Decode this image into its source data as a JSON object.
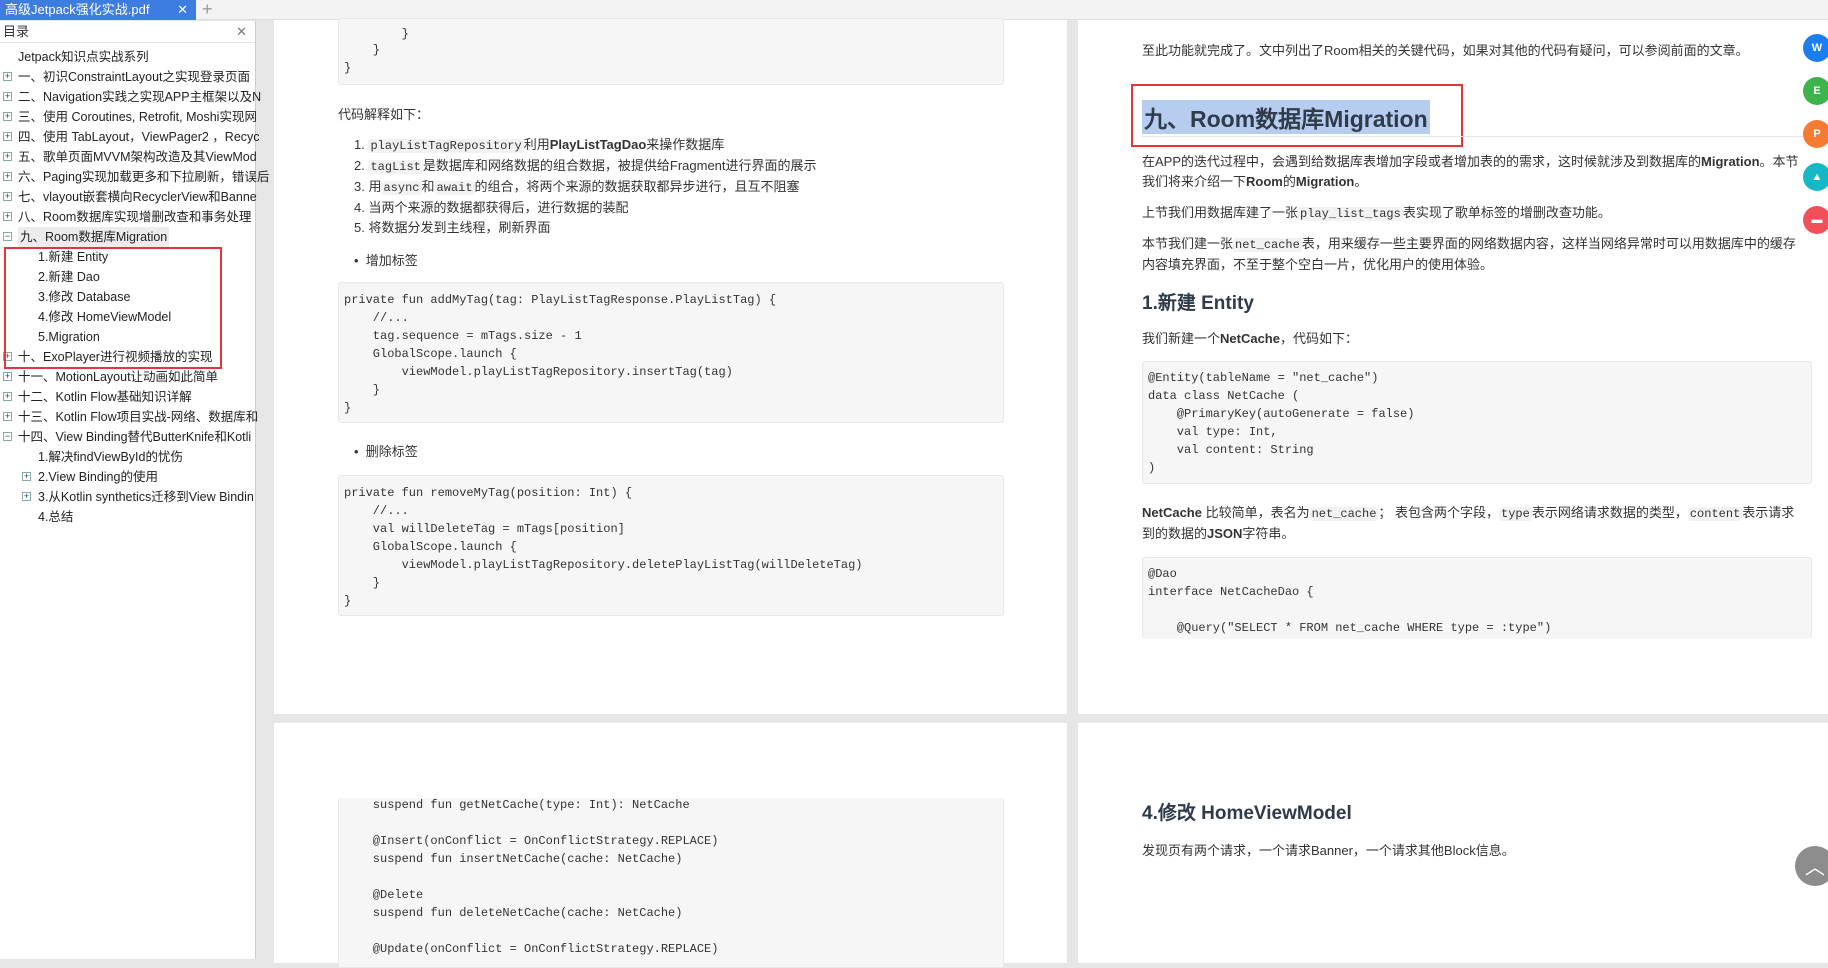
{
  "tabbar": {
    "active_tab": "高级Jetpack强化实战.pdf",
    "close": "✕",
    "new_tab": "+"
  },
  "sidebar": {
    "title": "目录",
    "close": "✕",
    "items": [
      {
        "label": "Jetpack知识点实战系列",
        "level": 0,
        "toggle": ""
      },
      {
        "label": "一、初识ConstraintLayout之实现登录页面",
        "level": 0,
        "toggle": "+"
      },
      {
        "label": "二、Navigation实践之实现APP主框架以及N",
        "level": 0,
        "toggle": "+"
      },
      {
        "label": "三、使用 Coroutines, Retrofit, Moshi实现网",
        "level": 0,
        "toggle": "+"
      },
      {
        "label": "四、使用 TabLayout，ViewPager2 ，Recyc",
        "level": 0,
        "toggle": "+"
      },
      {
        "label": "五、歌单页面MVVM架构改造及其ViewMod",
        "level": 0,
        "toggle": "+"
      },
      {
        "label": "六、Paging实现加载更多和下拉刷新，错误后",
        "level": 0,
        "toggle": "+"
      },
      {
        "label": "七、vlayout嵌套横向RecyclerView和Banne",
        "level": 0,
        "toggle": "+"
      },
      {
        "label": "八、Room数据库实现增删改查和事务处理",
        "level": 0,
        "toggle": "+"
      },
      {
        "label": "九、Room数据库Migration",
        "level": 0,
        "toggle": "-",
        "selected": true
      },
      {
        "label": "1.新建 Entity",
        "level": 1,
        "toggle": ""
      },
      {
        "label": "2.新建 Dao",
        "level": 1,
        "toggle": ""
      },
      {
        "label": "3.修改 Database",
        "level": 1,
        "toggle": ""
      },
      {
        "label": "4.修改 HomeViewModel",
        "level": 1,
        "toggle": ""
      },
      {
        "label": "5.Migration",
        "level": 1,
        "toggle": ""
      },
      {
        "label": "十、ExoPlayer进行视频播放的实现",
        "level": 0,
        "toggle": "+"
      },
      {
        "label": "十一、MotionLayout让动画如此简单",
        "level": 0,
        "toggle": "+"
      },
      {
        "label": "十二、Kotlin Flow基础知识详解",
        "level": 0,
        "toggle": "+"
      },
      {
        "label": "十三、Kotlin Flow项目实战-网络、数据库和",
        "level": 0,
        "toggle": "+"
      },
      {
        "label": "十四、View Binding替代ButterKnife和Kotli",
        "level": 0,
        "toggle": "-"
      },
      {
        "label": "1.解决findViewById的忧伤",
        "level": 1,
        "toggle": ""
      },
      {
        "label": "2.View Binding的使用",
        "level": 1,
        "toggle": "+"
      },
      {
        "label": "3.从Kotlin synthetics迁移到View Bindin",
        "level": 1,
        "toggle": "+"
      },
      {
        "label": "4.总结",
        "level": 1,
        "toggle": ""
      }
    ]
  },
  "page_left": {
    "code_top": [
      "        }",
      "    }",
      "}"
    ],
    "explain": "代码解释如下：",
    "list": [
      {
        "n": "1.",
        "code": "playListTagRepository",
        "text": "利用",
        "bold": "PlayListTagDao",
        "rest": "来操作数据库"
      },
      {
        "n": "2.",
        "code": "tagList",
        "text": "是数据库和网络数据的组合数据，被提供给Fragment进行界面的展示"
      },
      {
        "n": "3.",
        "pre": "用",
        "code": "async",
        "mid": "和",
        "code2": "await",
        "text": "的组合，将两个来源的数据获取都异步进行，且互不阻塞"
      },
      {
        "n": "4.",
        "text": "当两个来源的数据都获得后，进行数据的装配"
      },
      {
        "n": "5.",
        "text": "将数据分发到主线程，刷新界面"
      }
    ],
    "bullet_add": "增加标签",
    "code_add": [
      "private fun addMyTag(tag: PlayListTagResponse.PlayListTag) {",
      "    //...",
      "    tag.sequence = mTags.size - 1",
      "    GlobalScope.launch {",
      "        viewModel.playListTagRepository.insertTag(tag)",
      "    }",
      "}"
    ],
    "bullet_del": "删除标签",
    "code_del": [
      "private fun removeMyTag(position: Int) {",
      "    //...",
      "    val willDeleteTag = mTags[position]",
      "    GlobalScope.launch {",
      "        viewModel.playListTagRepository.deletePlayListTag(willDeleteTag)",
      "    }",
      "}"
    ]
  },
  "page_right": {
    "intro": "至此功能就完成了。文中列出了Room相关的关键代码，如果对其他的代码有疑问，可以参阅前面的文章。",
    "heading": "九、Room数据库Migration",
    "p1a": "在APP的迭代过程中，会遇到给数据库表增加字段或者增加表的的需求，这时候就涉及到数据库的",
    "p1b": "Migration",
    "p1c": "。本节",
    "p1d": "我们将来介绍一下",
    "p1e": "Room",
    "p1f": "的",
    "p1g": "Migration",
    "p1h": "。",
    "p2a": "上节我们用数据库建了一张",
    "p2code": "play_list_tags",
    "p2b": "表实现了歌单标签的增删改查功能。",
    "p3a": "本节我们建一张",
    "p3code": "net_cache",
    "p3b": "表，用来缓存一些主要界面的网络数据内容，这样当网络异常时可以用数据库中的缓存",
    "p3c": "内容填充界面，不至于整个空白一片，优化用户的使用体验。",
    "h_entity": "1.新建 Entity",
    "p4a": "我们新建一个",
    "p4b": "NetCache",
    "p4c": "，代码如下：",
    "code_entity": [
      "@Entity(tableName = \"net_cache\")",
      "data class NetCache (",
      "    @PrimaryKey(autoGenerate = false)",
      "    val type: Int,",
      "    val content: String",
      ")"
    ],
    "p5a": "NetCache",
    "p5b": " 比较简单，表名为",
    "p5c1": "net_cache",
    "p5d": "；  表包含两个字段，",
    "p5c2": "type",
    "p5e": "表示网络请求数据的类型，",
    "p5c3": "content",
    "p5f": "表示请求",
    "p5g": "到的数据的",
    "p5h": "JSON",
    "p5i": "字符串。",
    "code_dao": [
      "@Dao",
      "interface NetCacheDao {",
      "",
      "    @Query(\"SELECT * FROM net_cache WHERE type = :type\")"
    ]
  },
  "page_left_2": {
    "code": [
      "    suspend fun getNetCache(type: Int): NetCache",
      "",
      "    @Insert(onConflict = OnConflictStrategy.REPLACE)",
      "    suspend fun insertNetCache(cache: NetCache)",
      "",
      "    @Delete",
      "    suspend fun deleteNetCache(cache: NetCache)",
      "",
      "    @Update(onConflict = OnConflictStrategy.REPLACE)"
    ]
  },
  "page_right_2": {
    "heading": "4.修改 HomeViewModel",
    "text": "发现页有两个请求，一个请求Banner，一个请求其他Block信息。"
  },
  "float_tools": [
    {
      "icon": "word-convert-icon",
      "label": "W",
      "color": "#1a7ef0"
    },
    {
      "icon": "excel-convert-icon",
      "label": "E",
      "color": "#3cb44b"
    },
    {
      "icon": "ppt-convert-icon",
      "label": "P",
      "color": "#f57b32"
    },
    {
      "icon": "image-convert-icon",
      "label": "▲",
      "color": "#15b8c4"
    },
    {
      "icon": "print-icon",
      "label": "▬",
      "color": "#f0505a"
    }
  ],
  "scroll_top": "︿"
}
